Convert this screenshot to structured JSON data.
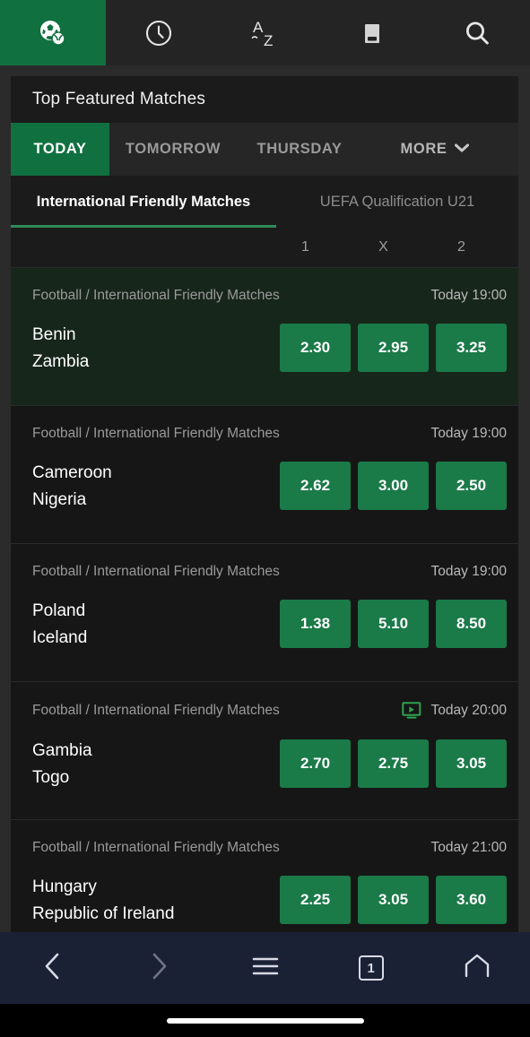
{
  "topnav": {
    "items": [
      {
        "icon": "sports-ball-icon",
        "name": "sports",
        "active": true
      },
      {
        "icon": "clock-icon",
        "name": "live-schedule",
        "active": false
      },
      {
        "icon": "a-z-sort-icon",
        "name": "az-sort",
        "active": false
      },
      {
        "icon": "betslip-icon",
        "name": "betslip",
        "active": false
      },
      {
        "icon": "search-icon",
        "name": "search",
        "active": false
      }
    ]
  },
  "card": {
    "title": "Top Featured Matches"
  },
  "day_tabs": [
    {
      "label": "TODAY",
      "active": true
    },
    {
      "label": "TOMORROW",
      "active": false
    },
    {
      "label": "THURSDAY",
      "active": false
    },
    {
      "label": "MORE",
      "active": false,
      "chevron": "❯"
    }
  ],
  "league_tabs": [
    {
      "label": "International Friendly Matches",
      "active": true
    },
    {
      "label": "UEFA Qualification U21",
      "active": false
    }
  ],
  "odds_header": [
    "1",
    "X",
    "2"
  ],
  "matches": [
    {
      "league": "Football / International Friendly Matches",
      "time": "Today 19:00",
      "stream": false,
      "home": "Benin",
      "away": "Zambia",
      "odds": [
        "2.30",
        "2.95",
        "3.25"
      ],
      "highlight": true
    },
    {
      "league": "Football / International Friendly Matches",
      "time": "Today 19:00",
      "stream": false,
      "home": "Cameroon",
      "away": "Nigeria",
      "odds": [
        "2.62",
        "3.00",
        "2.50"
      ],
      "highlight": false
    },
    {
      "league": "Football / International Friendly Matches",
      "time": "Today 19:00",
      "stream": false,
      "home": "Poland",
      "away": "Iceland",
      "odds": [
        "1.38",
        "5.10",
        "8.50"
      ],
      "highlight": false
    },
    {
      "league": "Football / International Friendly Matches",
      "time": "Today 20:00",
      "stream": true,
      "home": "Gambia",
      "away": "Togo",
      "odds": [
        "2.70",
        "2.75",
        "3.05"
      ],
      "highlight": false
    },
    {
      "league": "Football / International Friendly Matches",
      "time": "Today 21:00",
      "stream": false,
      "home": "Hungary",
      "away": "Republic of Ireland",
      "odds": [
        "2.25",
        "3.05",
        "3.60"
      ],
      "highlight": false
    }
  ],
  "bottom_bar": {
    "items": [
      {
        "icon": "back-chevron-icon",
        "name": "browser-back"
      },
      {
        "icon": "forward-chevron-icon",
        "name": "browser-forward"
      },
      {
        "icon": "hamburger-menu-icon",
        "name": "browser-menu"
      },
      {
        "icon": "tab-count-icon",
        "name": "browser-tabs",
        "label": "1"
      },
      {
        "icon": "home-icon",
        "name": "browser-home"
      }
    ]
  },
  "colors": {
    "accent_green": "#117040",
    "odds_green": "#1a7a48",
    "tab_underline": "#2e8b57",
    "card_bg": "#161616",
    "page_bg": "#2b2b2b",
    "highlight_row": "#17261a",
    "bottom_bar": "#1b2135"
  }
}
